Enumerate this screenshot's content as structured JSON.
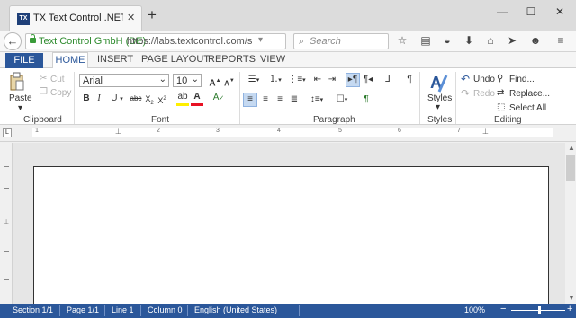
{
  "browser": {
    "tab_title": "TX Text Control .NET Serv...",
    "tab_icon_text": "TX",
    "identity": "Text Control GmbH (DE)",
    "url": "https://labs.textcontrol.com/simp",
    "search_placeholder": "Search"
  },
  "ribbon_tabs": [
    "FILE",
    "HOME",
    "INSERT",
    "PAGE LAYOUT",
    "REPORTS",
    "VIEW"
  ],
  "clipboard": {
    "paste": "Paste",
    "cut": "Cut",
    "copy": "Copy",
    "group": "Clipboard"
  },
  "font": {
    "name": "Arial",
    "size": "10",
    "group": "Font"
  },
  "paragraph": {
    "group": "Paragraph"
  },
  "styles": {
    "label": "Styles",
    "group": "Styles"
  },
  "editing": {
    "undo": "Undo",
    "redo": "Redo",
    "find": "Find...",
    "replace": "Replace...",
    "select_all": "Select All",
    "group": "Editing"
  },
  "ruler": {
    "numbers": [
      "1",
      "2",
      "3",
      "4",
      "5",
      "6",
      "7"
    ]
  },
  "status": {
    "section": "Section 1/1",
    "page": "Page 1/1",
    "line": "Line 1",
    "column": "Column 0",
    "language": "English (United States)",
    "zoom": "100%"
  },
  "colors": {
    "accent": "#2b579a",
    "secure": "#2e8b2e"
  }
}
